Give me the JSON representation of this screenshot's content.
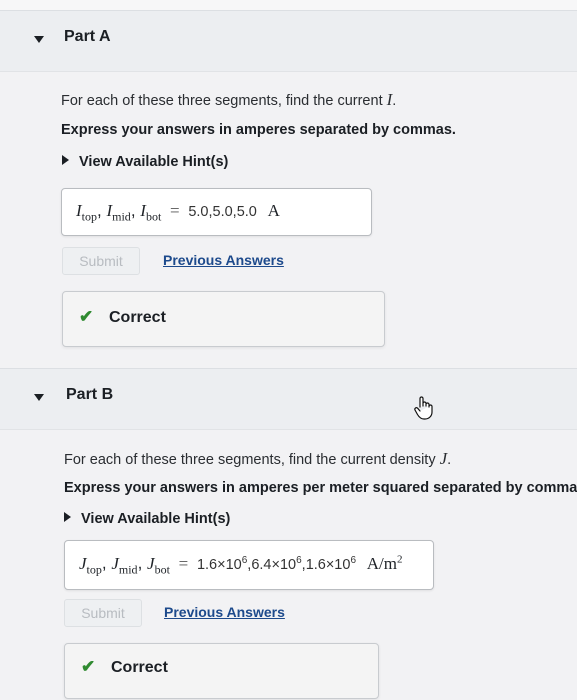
{
  "partA": {
    "title": "Part A",
    "question": "For each of these three segments, find the current",
    "question_var": "I",
    "question_end": ".",
    "instruction": "Express your answers in amperes separated by commas.",
    "hint": "View Available Hint(s)",
    "answer": {
      "labels": [
        "I",
        "top",
        "I",
        "mid",
        "I",
        "bot"
      ],
      "value": "5.0,5.0,5.0",
      "unit": "A"
    },
    "submit": "Submit",
    "previous": "Previous Answers",
    "result": "Correct"
  },
  "partB": {
    "title": "Part B",
    "question": "For each of these three segments, find the current density",
    "question_var": "J",
    "question_end": ".",
    "instruction": "Express your answers in amperes per meter squared separated by commas",
    "hint": "View Available Hint(s)",
    "answer": {
      "labels": [
        "J",
        "top",
        "J",
        "mid",
        "J",
        "bot"
      ],
      "v1": "1.6×10",
      "e1": "6",
      "v2": "6.4×10",
      "e2": "6",
      "v3": "1.6×10",
      "e3": "6",
      "unit": "A/m",
      "unit_exp": "2"
    },
    "submit": "Submit",
    "previous": "Previous Answers",
    "result": "Correct"
  },
  "icons": {
    "expand": "caret-down-icon",
    "hint": "caret-right-icon",
    "check": "checkmark-icon",
    "cursor": "hand-pointer-icon"
  },
  "colors": {
    "link": "#1d4a8c",
    "check": "#2f8a30"
  }
}
